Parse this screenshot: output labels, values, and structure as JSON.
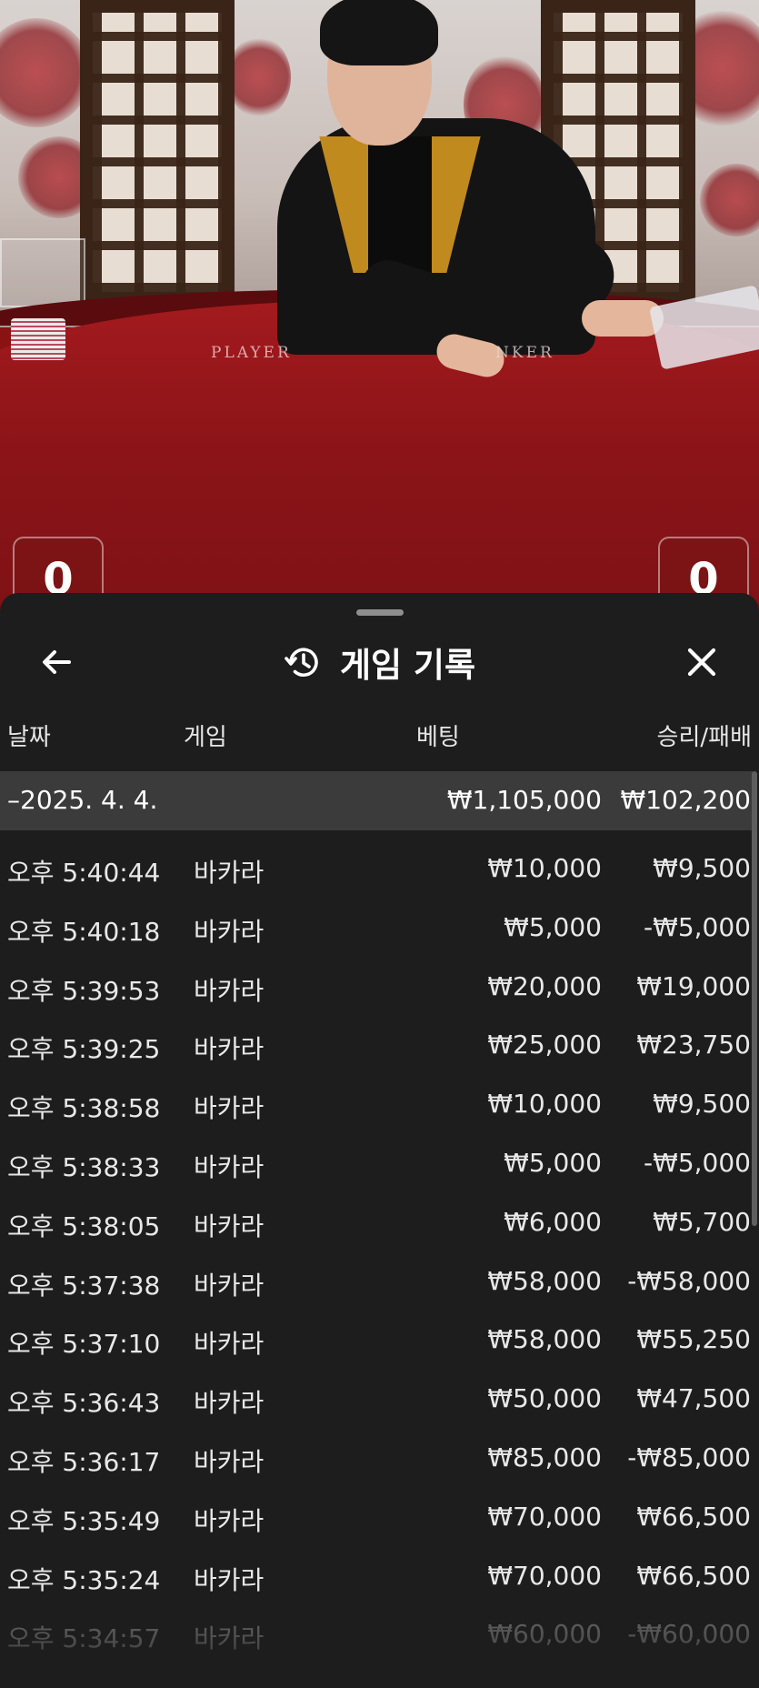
{
  "video": {
    "table_label_left": "PLAYER",
    "table_label_right": "NKER",
    "player_score": "0",
    "banker_score": "0"
  },
  "sheet": {
    "title": "게임 기록",
    "icons": {
      "back": "arrow-left-icon",
      "history": "history-clock-icon",
      "close": "close-x-icon"
    },
    "columns": {
      "date": "날짜",
      "game": "게임",
      "bet": "베팅",
      "result": "승리/패배"
    },
    "date_group": {
      "date": "–2025. 4. 4.",
      "total_bet": "₩1,105,000",
      "total_result": "₩102,200"
    },
    "rows": [
      {
        "time": "오후 5:40:44",
        "game": "바카라",
        "bet": "₩10,000",
        "result": "₩9,500"
      },
      {
        "time": "오후 5:40:18",
        "game": "바카라",
        "bet": "₩5,000",
        "result": "-₩5,000"
      },
      {
        "time": "오후 5:39:53",
        "game": "바카라",
        "bet": "₩20,000",
        "result": "₩19,000"
      },
      {
        "time": "오후 5:39:25",
        "game": "바카라",
        "bet": "₩25,000",
        "result": "₩23,750"
      },
      {
        "time": "오후 5:38:58",
        "game": "바카라",
        "bet": "₩10,000",
        "result": "₩9,500"
      },
      {
        "time": "오후 5:38:33",
        "game": "바카라",
        "bet": "₩5,000",
        "result": "-₩5,000"
      },
      {
        "time": "오후 5:38:05",
        "game": "바카라",
        "bet": "₩6,000",
        "result": "₩5,700"
      },
      {
        "time": "오후 5:37:38",
        "game": "바카라",
        "bet": "₩58,000",
        "result": "-₩58,000"
      },
      {
        "time": "오후 5:37:10",
        "game": "바카라",
        "bet": "₩58,000",
        "result": "₩55,250"
      },
      {
        "time": "오후 5:36:43",
        "game": "바카라",
        "bet": "₩50,000",
        "result": "₩47,500"
      },
      {
        "time": "오후 5:36:17",
        "game": "바카라",
        "bet": "₩85,000",
        "result": "-₩85,000"
      },
      {
        "time": "오후 5:35:49",
        "game": "바카라",
        "bet": "₩70,000",
        "result": "₩66,500"
      },
      {
        "time": "오후 5:35:24",
        "game": "바카라",
        "bet": "₩70,000",
        "result": "₩66,500"
      },
      {
        "time": "오후 5:34:57",
        "game": "바카라",
        "bet": "₩60,000",
        "result": "-₩60,000"
      }
    ]
  }
}
